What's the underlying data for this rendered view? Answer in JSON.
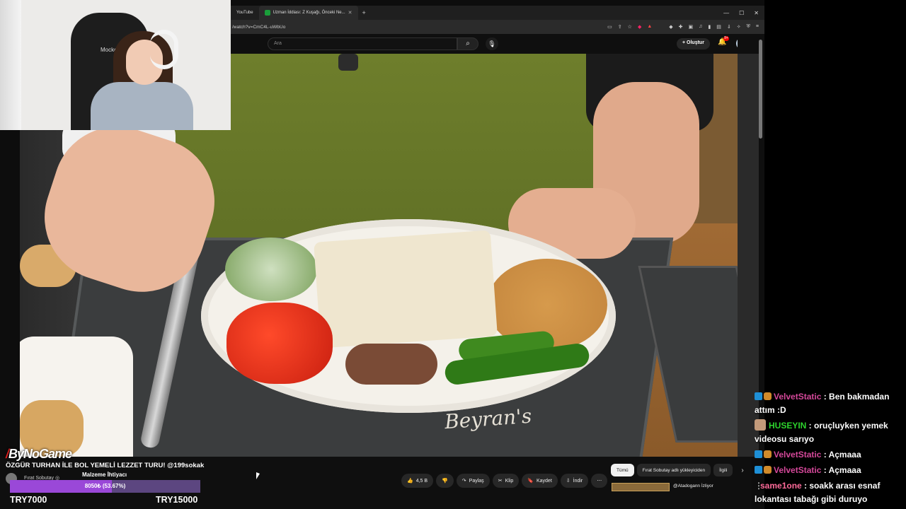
{
  "browser": {
    "tabs": [
      {
        "label": "YouTube",
        "active": false
      },
      {
        "label": "Uzman İddiası: Z Kuşağı, Önceki Ne...",
        "active": true
      }
    ],
    "url": "/watch?v=CmC4L-uWbUo"
  },
  "youtube": {
    "search_placeholder": "Ara",
    "create_label": "Oluştur",
    "notifications": "9+"
  },
  "webcam": {
    "chair_label": "Mockermon"
  },
  "video": {
    "brand_text": "Beyran's"
  },
  "stream_overlay": {
    "logo": "ByNoGame",
    "video_title": "ÖZGÜR TURHAN İLE BOL YEMELİ LEZZET TURU! @199sokak",
    "channel_name": "Fırat Sobutay ◎",
    "overlay_note": "Malzeme İhtiyacı",
    "progress_text": "8050₺ (53.67%)",
    "progress_fraction": 0.5367,
    "goal_min": "TRY7000",
    "goal_max": "TRY15000"
  },
  "actions": {
    "like": "4,5 B",
    "share": "Paylaş",
    "clip": "Klip",
    "save": "Kaydet",
    "download": "İndir"
  },
  "chips": [
    "Tümü",
    "Fırat Sobutay adlı yükleyiciden",
    "İlgili"
  ],
  "recommended": {
    "channel": "@Atadogann İzliyor"
  },
  "chat": [
    {
      "user": "VelvetStatic",
      "color": "#d5489a",
      "message": "Ben bakmadan attım :D",
      "badges": "ab"
    },
    {
      "user": "HUSEYIN",
      "color": "#2dd32d",
      "message": "oruçluyken yemek videosu sarıyo",
      "badges": "c"
    },
    {
      "user": "VelvetStatic",
      "color": "#d5489a",
      "message": "Açmaaa",
      "badges": "ab"
    },
    {
      "user": "VelvetStatic",
      "color": "#d5489a",
      "message": "Açmaaa",
      "badges": "ab"
    },
    {
      "user": "same1one",
      "color": "#ff6b9a",
      "message": "soakk arası esnaf lokantası tabağı gibi duruyo",
      "badges": "dots"
    }
  ],
  "colors": {
    "accent_purple": "#9a48d8",
    "chat_pink": "#d5489a",
    "chat_green": "#2dd32d"
  }
}
